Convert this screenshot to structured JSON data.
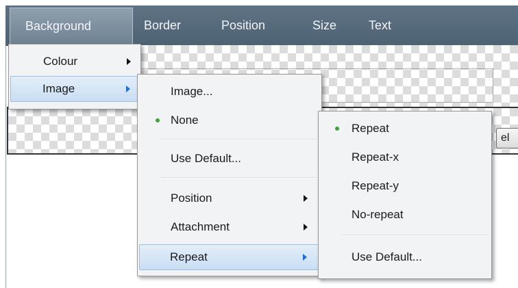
{
  "menubar": {
    "items": [
      {
        "label": "Background",
        "active": true
      },
      {
        "label": "Border"
      },
      {
        "label": "Position"
      },
      {
        "label": "Size"
      },
      {
        "label": "Text"
      }
    ]
  },
  "background_menu": {
    "items": [
      {
        "label": "Colour",
        "has_submenu": true
      },
      {
        "label": "Image",
        "has_submenu": true,
        "highlighted": true
      }
    ]
  },
  "image_menu": {
    "items": [
      {
        "label": "Image..."
      },
      {
        "label": "None",
        "checked": true
      },
      {
        "label": "Use Default..."
      },
      {
        "label": "Position",
        "has_submenu": true
      },
      {
        "label": "Attachment",
        "has_submenu": true
      },
      {
        "label": "Repeat",
        "has_submenu": true,
        "highlighted": true
      }
    ]
  },
  "repeat_menu": {
    "items": [
      {
        "label": "Repeat",
        "checked": true
      },
      {
        "label": "Repeat-x"
      },
      {
        "label": "Repeat-y"
      },
      {
        "label": "No-repeat"
      },
      {
        "label": "Use Default..."
      }
    ]
  },
  "partial_button": {
    "label": "el"
  },
  "colors": {
    "menubar": "#566a7b",
    "highlight": "#c9def4",
    "check_bullet": "#3aa33a",
    "submenu_arrow_highlight": "#1e6ed8"
  }
}
